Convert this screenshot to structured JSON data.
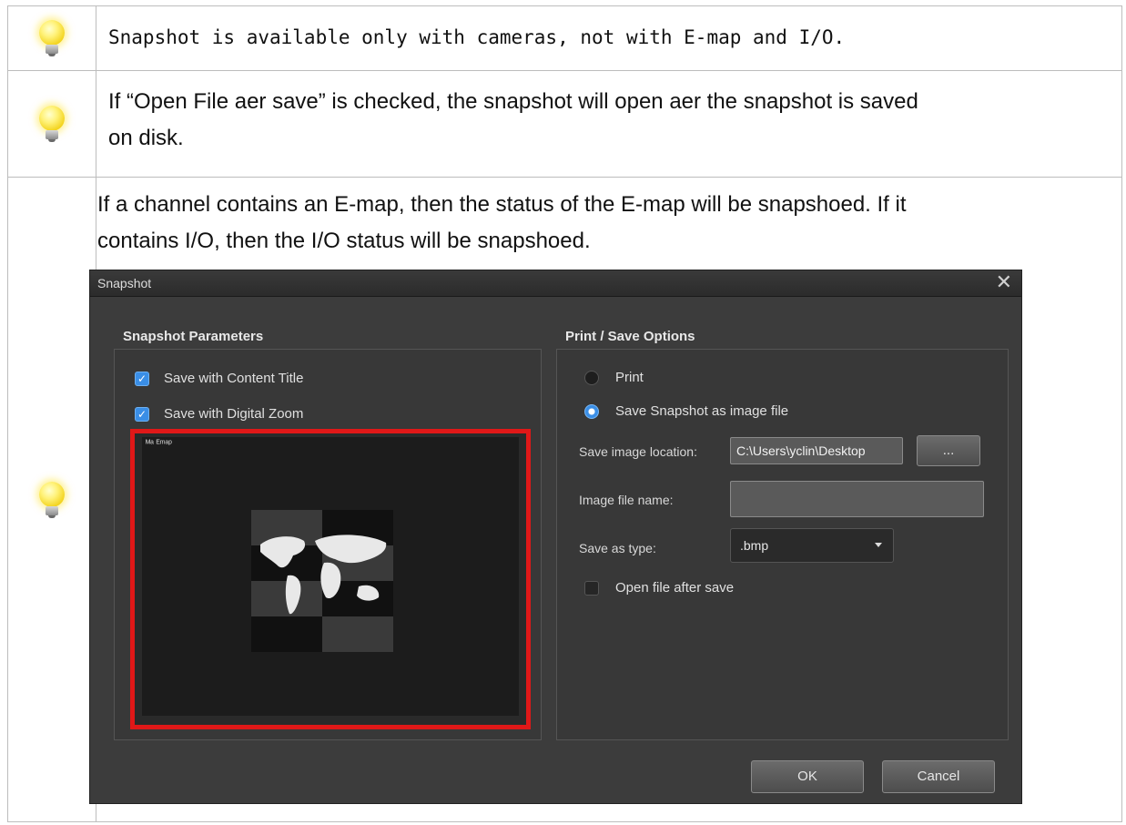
{
  "notes": [
    {
      "icon": "lightbulb-icon",
      "text": "Snapshot is available only with cameras, not with E-map and I/O."
    },
    {
      "icon": "lightbulb-icon",
      "lines": [
        "If “Open File aer save” is checked, the snapshot will open aer the snapshot is saved",
        "on disk."
      ]
    },
    {
      "icon": "lightbulb-icon",
      "lines": [
        "If a channel contains an E-map, then the status of the E-map will be snapshoed. If it",
        "contains I/O, then the I/O status will be snapshoed."
      ]
    }
  ],
  "dialog": {
    "title": "Snapshot",
    "close": "✕",
    "params": {
      "heading": "Snapshot Parameters",
      "save_content_title": "Save with Content Title",
      "save_digital_zoom": "Save with Digital Zoom",
      "preview_caption": "ᴹᵃ ᴱᵐᵃᵖ"
    },
    "options": {
      "heading": "Print / Save Options",
      "print": "Print",
      "save_as_image": "Save Snapshot as image file",
      "location_label": "Save image location:",
      "location_value": "C:\\Users\\yclin\\Desktop",
      "browse": "...",
      "file_name_label": "Image file name:",
      "file_name_value": "",
      "type_label": "Save as type:",
      "type_value": ".bmp",
      "open_after_save": "Open file after save"
    },
    "ok": "OK",
    "cancel": "Cancel"
  },
  "colors": {
    "highlight": "#e01818",
    "accent": "#3a8ee6"
  }
}
